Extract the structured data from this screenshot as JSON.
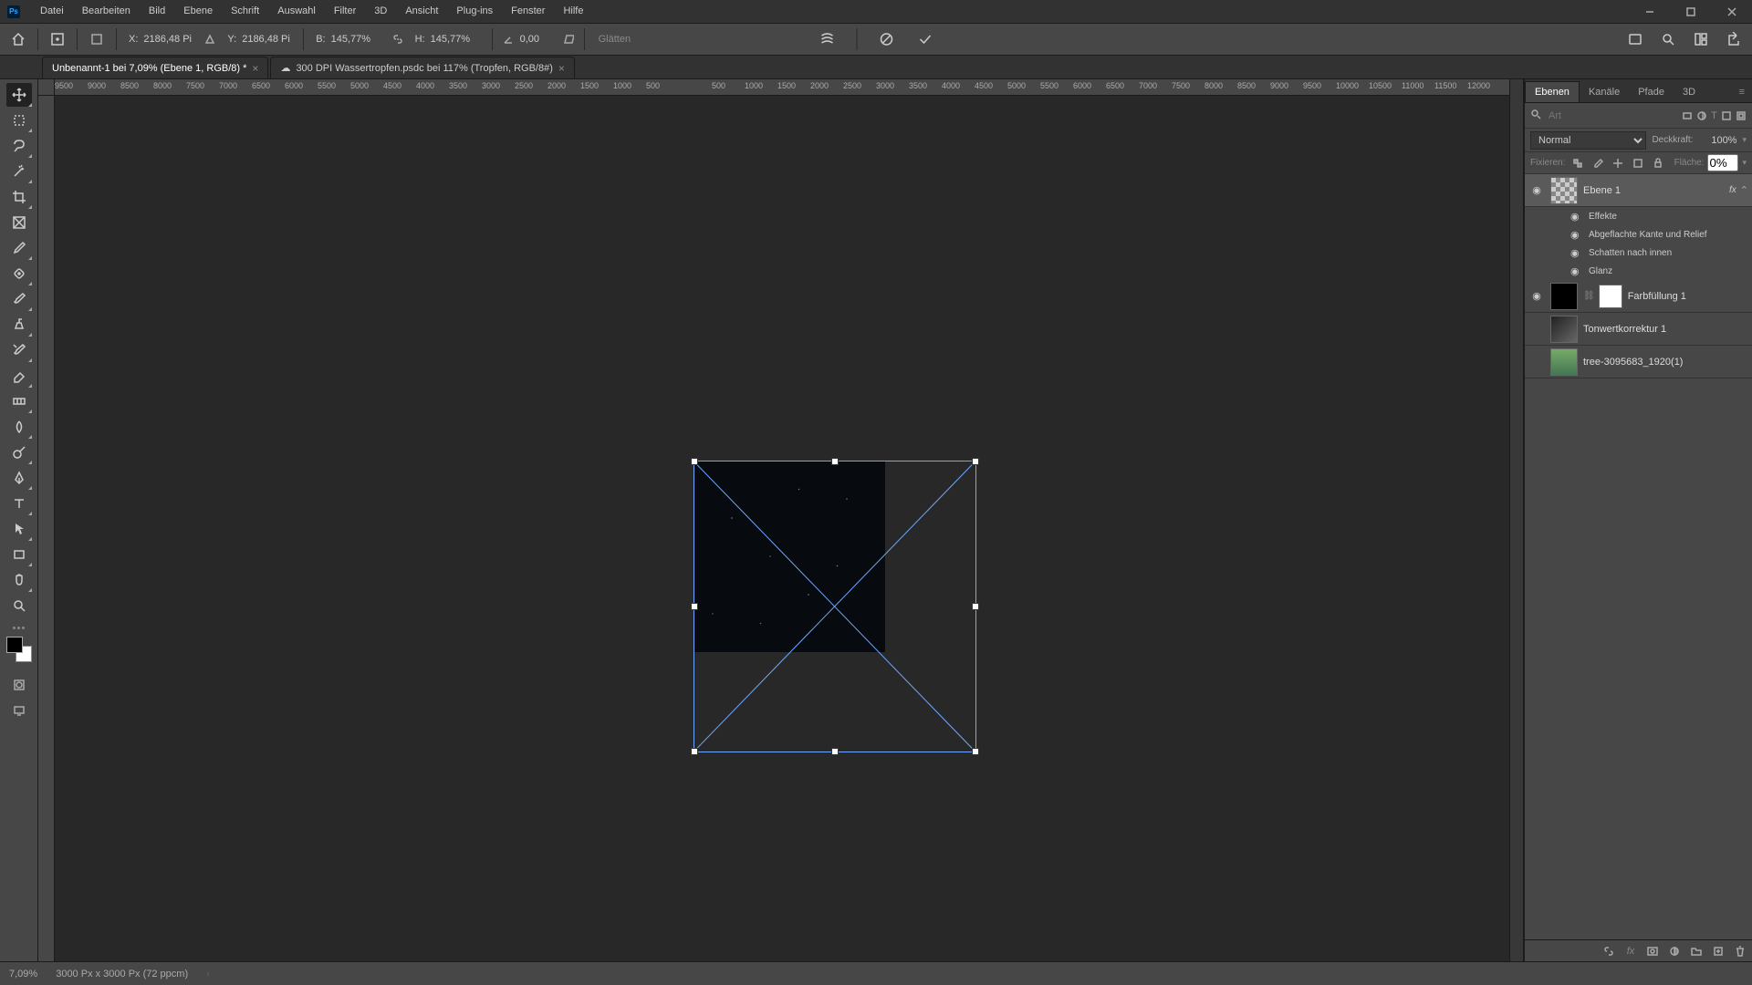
{
  "menu": [
    "Datei",
    "Bearbeiten",
    "Bild",
    "Ebene",
    "Schrift",
    "Auswahl",
    "Filter",
    "3D",
    "Ansicht",
    "Plug-ins",
    "Fenster",
    "Hilfe"
  ],
  "optionsbar": {
    "x_label": "X:",
    "x_value": "2186,48 Pi",
    "y_label": "Y:",
    "y_value": "2186,48 Pi",
    "w_label": "B:",
    "w_value": "145,77%",
    "h_label": "H:",
    "h_value": "145,77%",
    "angle_value": "0,00",
    "interpolation": "Glätten"
  },
  "tabs": [
    {
      "title": "Unbenannt-1 bei 7,09% (Ebene 1, RGB/8) *",
      "cloud": false
    },
    {
      "title": "300 DPI Wassertropfen.psdc bei 117% (Tropfen, RGB/8#)",
      "cloud": true
    }
  ],
  "ruler_marks": [
    "9500",
    "9000",
    "8500",
    "8000",
    "7500",
    "7000",
    "6500",
    "6000",
    "5500",
    "5000",
    "4500",
    "4000",
    "3500",
    "3000",
    "2500",
    "2000",
    "1500",
    "1000",
    "500",
    "",
    "500",
    "1000",
    "1500",
    "2000",
    "2500",
    "3000",
    "3500",
    "4000",
    "4500",
    "5000",
    "5500",
    "6000",
    "6500",
    "7000",
    "7500",
    "8000",
    "8500",
    "9000",
    "9500",
    "10000",
    "10500",
    "11000",
    "11500",
    "12000"
  ],
  "panel": {
    "tabs": [
      "Ebenen",
      "Kanäle",
      "Pfade",
      "3D"
    ],
    "search_placeholder": "Art",
    "blend_mode": "Normal",
    "opacity_label": "Deckkraft:",
    "opacity_value": "100%",
    "lock_label": "Fixieren:",
    "fill_label": "Fläche:",
    "fill_value": "0%"
  },
  "layers": {
    "l1": {
      "name": "Ebene 1",
      "fx_label": "fx"
    },
    "effects_header": "Effekte",
    "effects": [
      "Abgeflachte Kante und Relief",
      "Schatten nach innen",
      "Glanz"
    ],
    "l2": {
      "name": "Farbfüllung 1"
    },
    "l3": {
      "name": "Tonwertkorrektur 1"
    },
    "l4": {
      "name": "tree-3095683_1920(1)"
    }
  },
  "status": {
    "zoom": "7,09%",
    "info": "3000 Px x 3000 Px (72 ppcm)"
  }
}
